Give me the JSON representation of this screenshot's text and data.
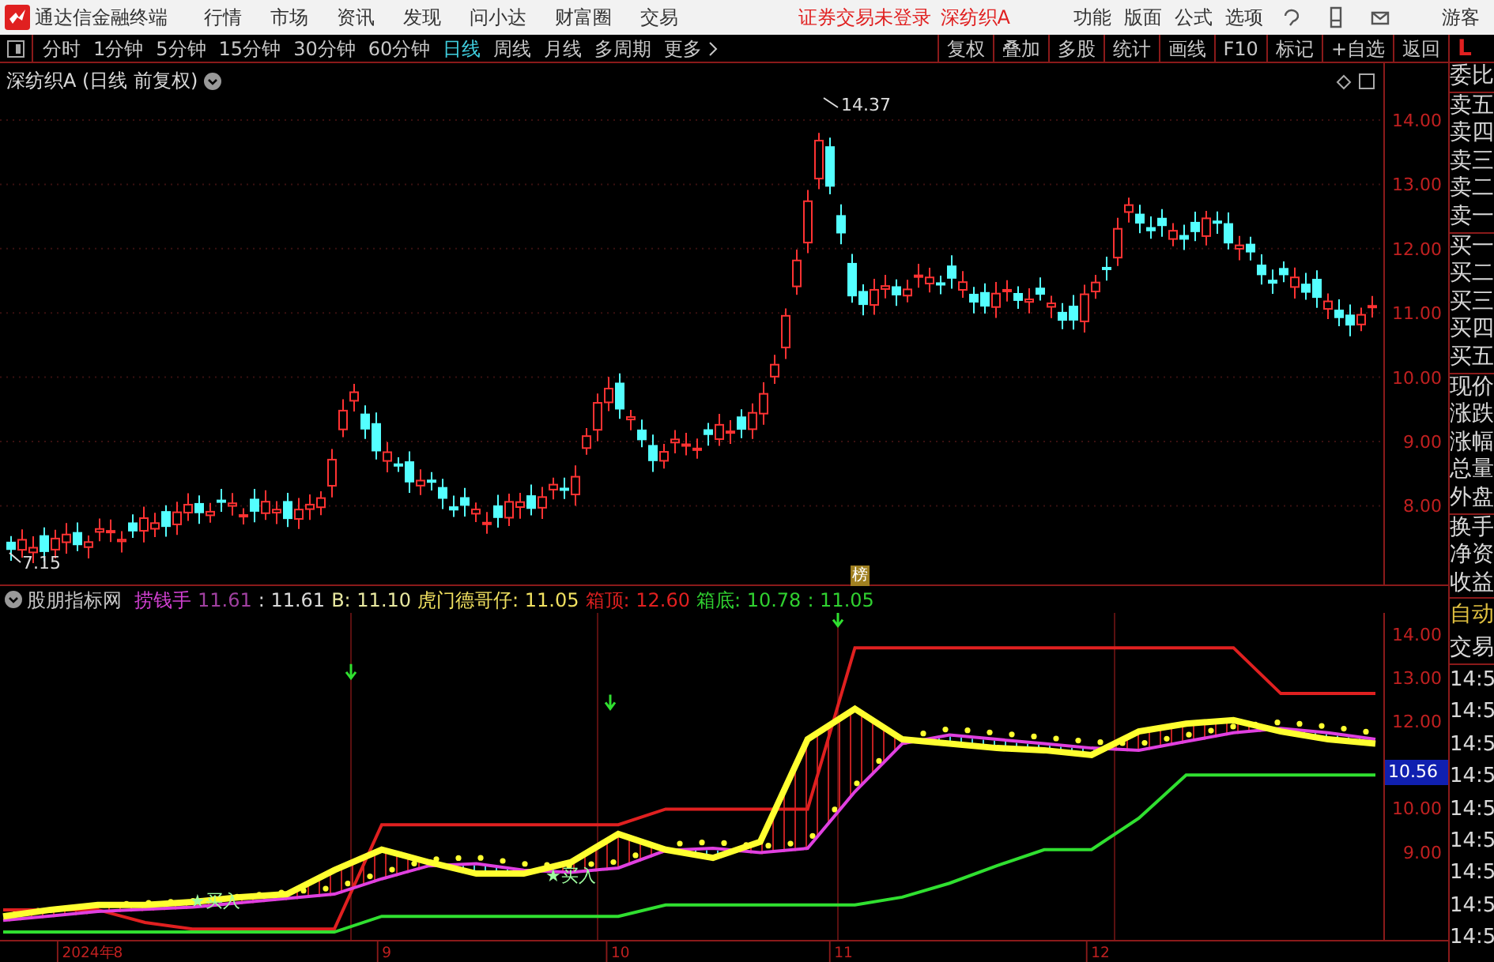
{
  "title_bar": {
    "app_name": "通达信金融终端",
    "menus": [
      "行情",
      "市场",
      "资讯",
      "发现",
      "问小达",
      "财富圈",
      "交易"
    ],
    "status": [
      "证券交易未登录",
      "深纺织A"
    ],
    "right_menus": [
      "功能",
      "版面",
      "公式",
      "选项"
    ],
    "user": "游客"
  },
  "period_tabs": [
    {
      "label": "分时",
      "selected": false
    },
    {
      "label": "1分钟",
      "selected": false
    },
    {
      "label": "5分钟",
      "selected": false
    },
    {
      "label": "15分钟",
      "selected": false
    },
    {
      "label": "30分钟",
      "selected": false
    },
    {
      "label": "60分钟",
      "selected": false
    },
    {
      "label": "日线",
      "selected": true
    },
    {
      "label": "周线",
      "selected": false
    },
    {
      "label": "月线",
      "selected": false
    },
    {
      "label": "多周期",
      "selected": false
    },
    {
      "label": "更多",
      "selected": false
    }
  ],
  "tool_buttons": [
    "复权",
    "叠加",
    "多股",
    "统计",
    "画线",
    "F10",
    "标记",
    "+自选",
    "返回"
  ],
  "side_panel": {
    "header": "L",
    "quote_groups": [
      [
        "委比"
      ],
      [
        "卖五",
        "卖四",
        "卖三",
        "卖二",
        "卖一"
      ],
      [
        "买一",
        "买二",
        "买三",
        "买四",
        "买五"
      ],
      [
        "现价",
        "涨跌",
        "涨幅",
        "总量",
        "外盘"
      ],
      [
        "换手",
        "净资",
        "收益"
      ]
    ],
    "auto_label": "自动",
    "trade_label": "交易",
    "times": [
      "14:5",
      "14:5",
      "14:5",
      "14:5",
      "14:5",
      "14:5",
      "14:5",
      "14:5",
      "14:5"
    ]
  },
  "price_chart": {
    "title": "深纺织A (日线 前复权)",
    "high_label": "14.37",
    "low_label": "7.15",
    "marker": "榜",
    "yticks": [
      "14.00",
      "13.00",
      "12.00",
      "11.00",
      "10.00",
      "9.00",
      "8.00"
    ]
  },
  "indicator": {
    "name": "股朋指标网",
    "legend": [
      {
        "text": "捞钱手",
        "color": "#d040d0"
      },
      {
        "text": "11.61",
        "color": "#a040a0"
      },
      {
        "text": ": 11.61",
        "color": "#d8d8d8"
      },
      {
        "text": "B: 11.10",
        "color": "#e8e8a0"
      },
      {
        "text": "虎门德哥仔: 11.05",
        "color": "#f0e060"
      },
      {
        "text": "箱顶: 12.60",
        "color": "#e02020"
      },
      {
        "text": "箱底: 10.78",
        "color": "#30d030"
      },
      {
        "text": ": 11.05",
        "color": "#30d030"
      }
    ],
    "current_value": "10.56",
    "signals": [
      "★买入",
      "★买入"
    ],
    "chart_data": {
      "type": "line",
      "ylim": [
        7,
        14.5
      ],
      "yticks": [
        {
          "value": 14,
          "label": "14.00"
        },
        {
          "value": 13,
          "label": "13.00"
        },
        {
          "value": 12,
          "label": "12.00"
        },
        {
          "value": 10,
          "label": "10.00"
        },
        {
          "value": 9,
          "label": "9.00"
        }
      ],
      "series": [
        {
          "color": "#e02020",
          "values": [
            7.69,
            7.69,
            7.69,
            7.4,
            7.25,
            7.25,
            7.25,
            7.25,
            9.64,
            9.64,
            9.64,
            9.64,
            9.64,
            9.64,
            10.0,
            10.0,
            10.0,
            10.0,
            13.7,
            13.7,
            13.7,
            13.7,
            13.7,
            13.7,
            13.7,
            13.7,
            13.7,
            12.65,
            12.65,
            12.65
          ]
        },
        {
          "color": "#30e030",
          "values": [
            7.18,
            7.18,
            7.18,
            7.18,
            7.18,
            7.18,
            7.18,
            7.18,
            7.54,
            7.54,
            7.54,
            7.54,
            7.54,
            7.54,
            7.8,
            7.8,
            7.8,
            7.8,
            7.8,
            7.98,
            8.3,
            8.7,
            9.07,
            9.07,
            9.79,
            10.78,
            10.78,
            10.78,
            10.78,
            10.78
          ]
        },
        {
          "color": "#e040e0",
          "values": [
            7.45,
            7.55,
            7.65,
            7.7,
            7.75,
            7.85,
            7.95,
            8.05,
            8.4,
            8.7,
            8.75,
            8.6,
            8.55,
            8.65,
            9.05,
            9.1,
            9.0,
            9.1,
            10.4,
            11.5,
            11.7,
            11.6,
            11.5,
            11.4,
            11.35,
            11.55,
            11.75,
            11.85,
            11.75,
            11.6
          ]
        },
        {
          "color": "#ffff30",
          "values": [
            7.54,
            7.69,
            7.8,
            7.8,
            7.87,
            7.98,
            8.05,
            8.6,
            9.07,
            8.78,
            8.52,
            8.52,
            8.78,
            9.43,
            9.07,
            8.88,
            9.25,
            11.6,
            12.3,
            11.6,
            11.5,
            11.4,
            11.35,
            11.24,
            11.78,
            11.96,
            12.04,
            11.78,
            11.6,
            11.5
          ]
        }
      ]
    }
  },
  "x_axis": [
    "2024年8",
    "9",
    "10",
    "11",
    "12"
  ]
}
